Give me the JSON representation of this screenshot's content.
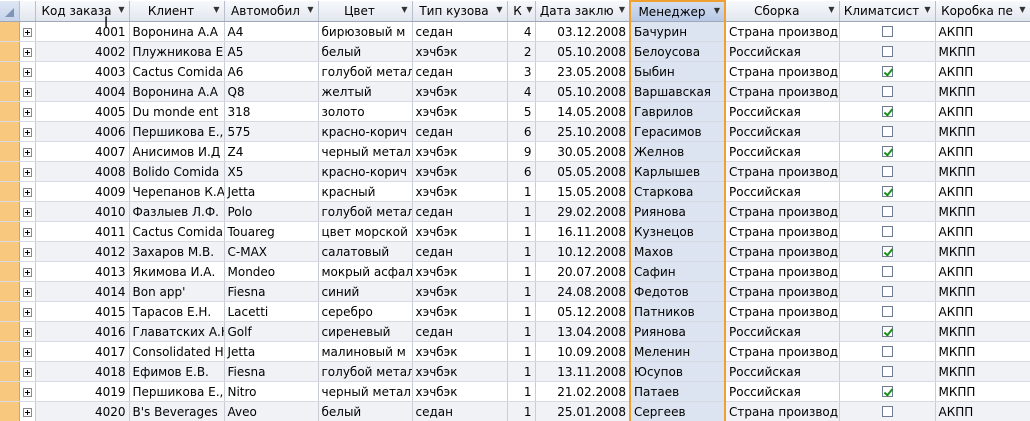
{
  "columns": [
    {
      "label": "Код заказа"
    },
    {
      "label": "Клиент"
    },
    {
      "label": "Автомобил"
    },
    {
      "label": "Цвет"
    },
    {
      "label": "Тип кузова"
    },
    {
      "label": "К"
    },
    {
      "label": "Дата заклю"
    },
    {
      "label": "Менеджер"
    },
    {
      "label": "Сборка"
    },
    {
      "label": "Климатсист"
    },
    {
      "label": "Коробка пе"
    }
  ],
  "rows": [
    {
      "id": "4001",
      "client": "Воронина А.А",
      "car": "A4",
      "color": "бирюзовый м",
      "body": "седан",
      "qty": "4",
      "date": "03.12.2008",
      "manager": "Бачурин",
      "assembly": "Страна производ",
      "climate": false,
      "gearbox": "АКПП"
    },
    {
      "id": "4002",
      "client": "Плужникова Е",
      "car": "A5",
      "color": "белый",
      "body": "хэчбэк",
      "qty": "2",
      "date": "05.10.2008",
      "manager": "Белоусова",
      "assembly": "Российская",
      "climate": false,
      "gearbox": "МКПП"
    },
    {
      "id": "4003",
      "client": "Cactus Comida",
      "car": "A6",
      "color": "голубой метал",
      "body": "седан",
      "qty": "3",
      "date": "23.05.2008",
      "manager": "Быбин",
      "assembly": "Страна производ",
      "climate": true,
      "gearbox": "АКПП"
    },
    {
      "id": "4004",
      "client": "Воронина А.А",
      "car": "Q8",
      "color": "желтый",
      "body": "хэчбэк",
      "qty": "4",
      "date": "05.10.2008",
      "manager": "Варшавская",
      "assembly": "Страна производ",
      "climate": false,
      "gearbox": "МКПП"
    },
    {
      "id": "4005",
      "client": "Du monde ent",
      "car": "318",
      "color": "золото",
      "body": "хэчбэк",
      "qty": "5",
      "date": "14.05.2008",
      "manager": "Гаврилов",
      "assembly": "Российская",
      "climate": true,
      "gearbox": "АКПП"
    },
    {
      "id": "4006",
      "client": "Першикова Е.,",
      "car": "575",
      "color": "красно-корич",
      "body": "седан",
      "qty": "6",
      "date": "25.10.2008",
      "manager": "Герасимов",
      "assembly": "Российская",
      "climate": false,
      "gearbox": "МКПП"
    },
    {
      "id": "4007",
      "client": "Анисимов И.Д",
      "car": "Z4",
      "color": "черный метал",
      "body": "хэчбэк",
      "qty": "9",
      "date": "30.05.2008",
      "manager": "Желнов",
      "assembly": "Российская",
      "climate": true,
      "gearbox": "АКПП"
    },
    {
      "id": "4008",
      "client": "Bolido Comida",
      "car": "X5",
      "color": "красно-корич",
      "body": "хэчбэк",
      "qty": "6",
      "date": "05.05.2008",
      "manager": "Карлышев",
      "assembly": "Страна производ",
      "climate": false,
      "gearbox": "МКПП"
    },
    {
      "id": "4009",
      "client": "Черепанов К.А",
      "car": "Jetta",
      "color": "красный",
      "body": "хэчбэк",
      "qty": "1",
      "date": "15.05.2008",
      "manager": "Старкова",
      "assembly": "Российская",
      "climate": true,
      "gearbox": "АКПП"
    },
    {
      "id": "4010",
      "client": "Фазлыев Л.Ф.",
      "car": "Polo",
      "color": "голубой метал",
      "body": "седан",
      "qty": "1",
      "date": "29.02.2008",
      "manager": "Риянова",
      "assembly": "Страна производ",
      "climate": false,
      "gearbox": "МКПП"
    },
    {
      "id": "4011",
      "client": "Cactus Comida",
      "car": "Touareg",
      "color": "цвет морской",
      "body": "хэчбэк",
      "qty": "1",
      "date": "16.11.2008",
      "manager": "Кузнецов",
      "assembly": "Страна производ",
      "climate": false,
      "gearbox": "АКПП"
    },
    {
      "id": "4012",
      "client": "Захаров М.В.",
      "car": "C-MAX",
      "color": "салатовый",
      "body": "седан",
      "qty": "1",
      "date": "10.12.2008",
      "manager": "Махов",
      "assembly": "Страна производ",
      "climate": true,
      "gearbox": "МКПП"
    },
    {
      "id": "4013",
      "client": "Якимова И.А.",
      "car": "Mondeo",
      "color": "мокрый асфал",
      "body": "хэчбэк",
      "qty": "1",
      "date": "20.07.2008",
      "manager": "Сафин",
      "assembly": "Страна производ",
      "climate": false,
      "gearbox": "АКПП"
    },
    {
      "id": "4014",
      "client": "Bon app'",
      "car": "Fiesna",
      "color": "синий",
      "body": "хэчбэк",
      "qty": "1",
      "date": "24.08.2008",
      "manager": "Федотов",
      "assembly": "Страна производ",
      "climate": false,
      "gearbox": "МКПП"
    },
    {
      "id": "4015",
      "client": "Тарасов Е.Н.",
      "car": "Lacetti",
      "color": "серебро",
      "body": "хэчбэк",
      "qty": "1",
      "date": "05.12.2008",
      "manager": "Патников",
      "assembly": "Страна производ",
      "climate": false,
      "gearbox": "АКПП"
    },
    {
      "id": "4016",
      "client": "Главатских А.Н",
      "car": "Golf",
      "color": "сиреневый",
      "body": "седан",
      "qty": "1",
      "date": "13.04.2008",
      "manager": "Риянова",
      "assembly": "Российская",
      "climate": true,
      "gearbox": "МКПП"
    },
    {
      "id": "4017",
      "client": "Consolidated H",
      "car": "Jetta",
      "color": "малиновый м",
      "body": "хэчбэк",
      "qty": "1",
      "date": "10.09.2008",
      "manager": "Меленин",
      "assembly": "Страна производ",
      "climate": false,
      "gearbox": "МКПП"
    },
    {
      "id": "4018",
      "client": "Ефимов Е.В.",
      "car": "Fiesna",
      "color": "голубой метал",
      "body": "хэчбэк",
      "qty": "1",
      "date": "13.11.2008",
      "manager": "Юсупов",
      "assembly": "Российская",
      "climate": false,
      "gearbox": "МКПП"
    },
    {
      "id": "4019",
      "client": "Першикова Е.,",
      "car": "Nitro",
      "color": "черный метал",
      "body": "хэчбэк",
      "qty": "1",
      "date": "21.02.2008",
      "manager": "Патаев",
      "assembly": "Российская",
      "climate": true,
      "gearbox": "МКПП"
    },
    {
      "id": "4020",
      "client": "B's Beverages",
      "car": "Aveo",
      "color": "белый",
      "body": "седан",
      "qty": "1",
      "date": "25.01.2008",
      "manager": "Сергеев",
      "assembly": "Страна производ",
      "climate": false,
      "gearbox": "АКПП"
    }
  ],
  "colors": {
    "selector": "#f8c87f",
    "highlight_border": "#f0a030",
    "check": "#1b8f1b"
  }
}
